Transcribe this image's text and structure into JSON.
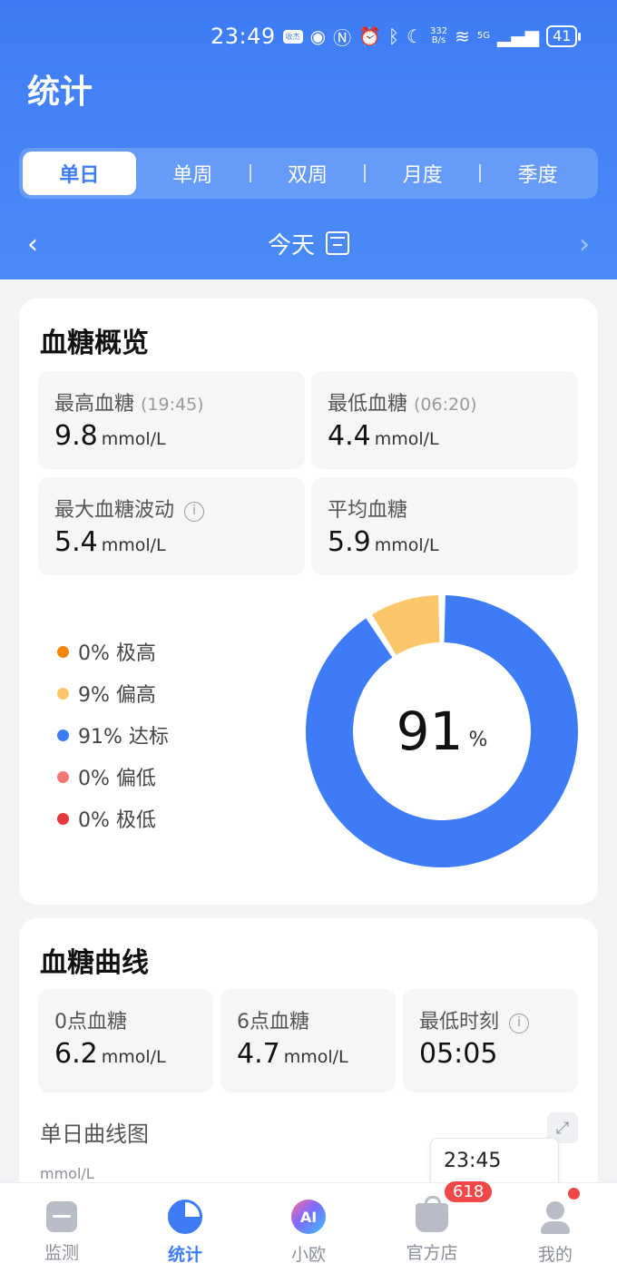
{
  "status_bar": {
    "time": "23:49",
    "badge": "收杰",
    "net_speed_top": "332",
    "net_speed_bottom": "B/s",
    "network": "5G",
    "battery": "41"
  },
  "header": {
    "title": "统计"
  },
  "tabs": [
    {
      "label": "单日",
      "active": true
    },
    {
      "label": "单周",
      "active": false
    },
    {
      "label": "双周",
      "active": false
    },
    {
      "label": "月度",
      "active": false
    },
    {
      "label": "季度",
      "active": false
    }
  ],
  "date_nav": {
    "label": "今天"
  },
  "overview": {
    "title": "血糖概览",
    "stats": [
      {
        "label": "最高血糖",
        "sub": "(19:45)",
        "value": "9.8",
        "unit": "mmol/L"
      },
      {
        "label": "最低血糖",
        "sub": "(06:20)",
        "value": "4.4",
        "unit": "mmol/L"
      },
      {
        "label": "最大血糖波动",
        "value": "5.4",
        "unit": "mmol/L"
      },
      {
        "label": "平均血糖",
        "value": "5.9",
        "unit": "mmol/L"
      }
    ],
    "info_glyph": "i",
    "legend": [
      {
        "label": "0% 极高",
        "color": "#f5870f",
        "percent": 0
      },
      {
        "label": "9% 偏高",
        "color": "#fcc76a",
        "percent": 9
      },
      {
        "label": "91% 达标",
        "color": "#3d7cf6",
        "percent": 91
      },
      {
        "label": "0% 偏低",
        "color": "#f47676",
        "percent": 0
      },
      {
        "label": "0% 极低",
        "color": "#e5383b",
        "percent": 0
      }
    ],
    "donut": {
      "value": "91",
      "unit": "%"
    }
  },
  "curve": {
    "title": "血糖曲线",
    "stats": [
      {
        "label": "0点血糖",
        "value": "6.2",
        "unit": "mmol/L"
      },
      {
        "label": "6点血糖",
        "value": "4.7",
        "unit": "mmol/L"
      },
      {
        "label": "最低时刻",
        "value": "05:05",
        "unit": ""
      }
    ],
    "subtitle": "单日曲线图",
    "unit_label": "mmol/L",
    "tooltip_time": "23:45"
  },
  "bottom_nav": [
    {
      "label": "监测",
      "active": false
    },
    {
      "label": "统计",
      "active": true
    },
    {
      "label": "小欧",
      "active": false,
      "icon_text": "AI"
    },
    {
      "label": "官方店",
      "active": false,
      "badge": "618"
    },
    {
      "label": "我的",
      "active": false
    }
  ]
}
